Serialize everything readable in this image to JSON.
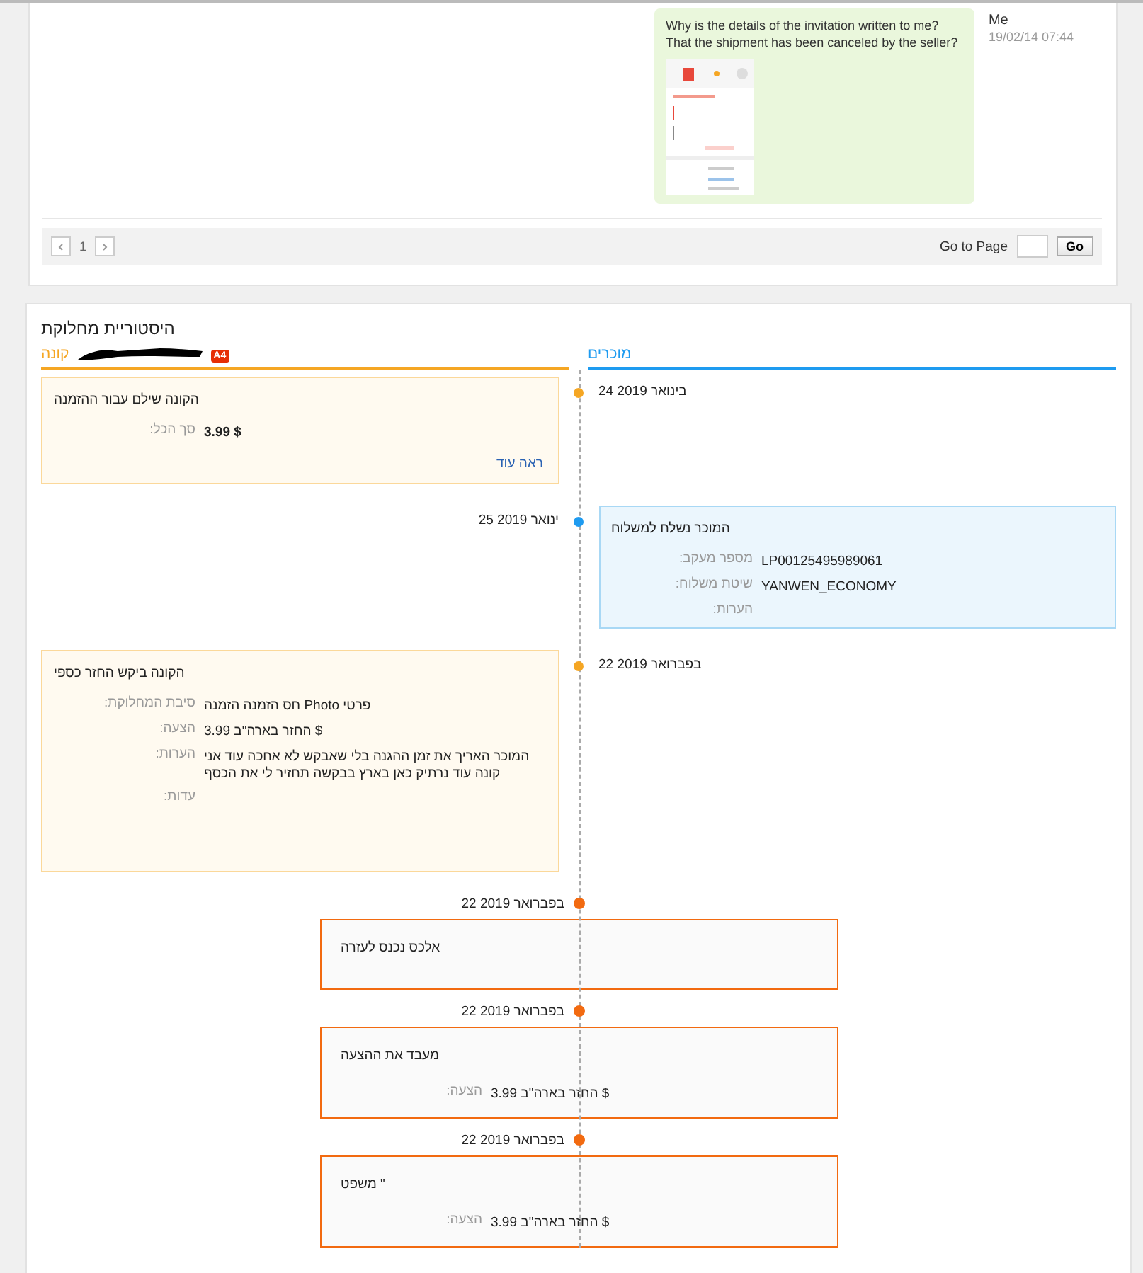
{
  "message": {
    "text_lines": [
      "Why is the details of the invitation written to me?",
      "That the shipment has been canceled by the seller?"
    ],
    "attachment": {
      "kind": "picture"
    },
    "author": "Me",
    "time": "19/02/14 07:44"
  },
  "pagination": {
    "page": "1",
    "goto_label": "Go to Page",
    "go_button": "Go"
  },
  "dispute": {
    "title": "היסטוריית מחלוקת",
    "buyer": {
      "badge": "A4",
      "label": "קונה"
    },
    "seller": {
      "label": "מוכרים"
    },
    "events": [
      {
        "kind": "buyer",
        "date": "בינואר 2019 24",
        "title": "הקונה שילם עבור ההזמנה",
        "fields": [
          {
            "label": "סך הכל:",
            "value": "$ 3.99",
            "bold": true
          }
        ],
        "link": "ראה עוד"
      },
      {
        "kind": "seller",
        "date": "ינואר 2019 25",
        "title": "המוכר נשלח למשלוח",
        "fields": [
          {
            "label": "מספר מעקב:",
            "value": "LP00125495989061"
          },
          {
            "label": "שיטת משלוח:",
            "value": "YANWEN_ECONOMY"
          },
          {
            "label": "הערות:"
          }
        ]
      },
      {
        "kind": "buyer",
        "date": "בפברואר 2019 22",
        "title": "הקונה ביקש החזר כספי",
        "fields": [
          {
            "label": "סיבת המחלוקת:",
            "value": "פרטי Photo חס הזמנה הזמנה"
          },
          {
            "label": "הצעה:",
            "value": "$ החזר בארה\"ב 3.99"
          },
          {
            "label": "הערות:",
            "value": "המוכר האריך את זמן ההגנה בלי שאבקש לא אחכה עוד אני קונה עוד נרתיק כאן בארץ בבקשה תחזיר לי את הכסף"
          },
          {
            "label": "עדות:"
          }
        ]
      },
      {
        "kind": "platform",
        "date": "בפברואר 2019 22",
        "title": "אלכס נכנס לעזרה"
      },
      {
        "kind": "platform",
        "date": "בפברואר 2019 22",
        "title": "מעבד את ההצעה",
        "fields": [
          {
            "label": "הצעה:",
            "value": "$ החזר בארה\"ב 3.99"
          }
        ]
      },
      {
        "kind": "platform",
        "date": "בפברואר 2019 22",
        "title": "\" משפט",
        "fields": [
          {
            "label": "הצעה:",
            "value": "$ החזר בארה\"ב 3.99"
          }
        ]
      }
    ]
  }
}
